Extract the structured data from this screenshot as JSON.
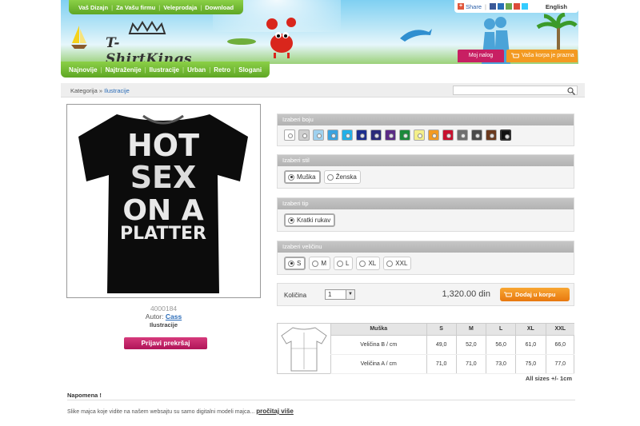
{
  "top_nav": [
    "Vaš Dizajn",
    "Za Vašu firmu",
    "Veleprodaja",
    "Download"
  ],
  "share": {
    "label": "Share",
    "language": "English"
  },
  "logo": {
    "text": "T-ShirtKings"
  },
  "account": {
    "my_account": "Moj nalog",
    "cart": "Vaša korpa je prazna"
  },
  "main_nav": [
    "Najnovije",
    "Najtraženije",
    "Ilustracije",
    "Urban",
    "Retro",
    "Slogani"
  ],
  "breadcrumb": {
    "prefix": "Kategorija »",
    "current": "Ilustracije"
  },
  "search": {
    "placeholder": ""
  },
  "product": {
    "image_text": [
      "HOT",
      "SEX",
      "ON A",
      "PLATTER"
    ],
    "id": "4000184",
    "author_label": "Autor:",
    "author": "Cass",
    "category": "Ilustracije",
    "report_button": "Prijavi prekršaj"
  },
  "color_panel": {
    "title": "Izaberi boju",
    "colors": [
      "#ffffff",
      "#cfcfcf",
      "#9fd1ef",
      "#3aa3e0",
      "#21b0e8",
      "#1d2f8f",
      "#2a2a7a",
      "#5b2a86",
      "#1b8a3a",
      "#f4ef8a",
      "#f39a21",
      "#c8102e",
      "#6e6e6e",
      "#4a4a4a",
      "#6b3a1e",
      "#111111"
    ],
    "selected_index": 15
  },
  "style_panel": {
    "title": "Izaberi stil",
    "options": [
      "Muška",
      "Ženska"
    ],
    "selected": "Muška"
  },
  "type_panel": {
    "title": "Izaberi tip",
    "options": [
      "Kratki rukav"
    ],
    "selected": "Kratki rukav"
  },
  "size_panel": {
    "title": "Izaberi veličinu",
    "options": [
      "S",
      "M",
      "L",
      "XL",
      "XXL"
    ],
    "selected": "S"
  },
  "quantity": {
    "label": "Količina",
    "value": "1",
    "price": "1,320.00 din",
    "add_button": "Dodaj u korpu"
  },
  "size_table": {
    "headers": [
      "Muška",
      "S",
      "M",
      "L",
      "XL",
      "XXL"
    ],
    "rows": [
      [
        "Veličina B / cm",
        "49,0",
        "52,0",
        "56,0",
        "61,0",
        "66,0"
      ],
      [
        "Veličina A / cm",
        "71,0",
        "71,0",
        "73,0",
        "75,0",
        "77,0"
      ]
    ],
    "note": "All sizes +/- 1cm"
  },
  "note": {
    "title": "Napomena !",
    "text": "Slike majca koje vidite na našem websajtu su samo digitalni modeli majca...",
    "link": "pročitaj više"
  }
}
